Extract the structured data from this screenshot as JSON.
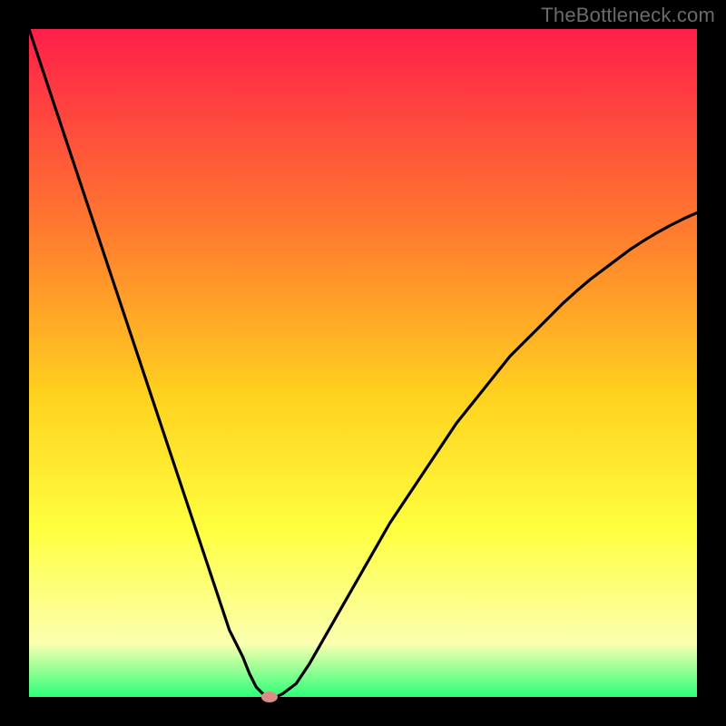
{
  "watermark": "TheBottleneck.com",
  "colors": {
    "black": "#000000",
    "gradient_top": "#ff1f4a",
    "gradient_mid1": "#ff7a2f",
    "gradient_mid2": "#ffd21f",
    "gradient_mid3": "#ffff40",
    "gradient_mid4": "#fbffb0",
    "gradient_bottom": "#2dff79",
    "line": "#000000",
    "dot": "#dd8b87",
    "watermark": "#6b6b6b"
  },
  "chart_data": {
    "type": "line",
    "title": "",
    "xlabel": "",
    "ylabel": "",
    "xlim": [
      0,
      100
    ],
    "ylim": [
      0,
      100
    ],
    "x": [
      0,
      2,
      4,
      6,
      8,
      10,
      12,
      14,
      16,
      18,
      20,
      22,
      24,
      26,
      28,
      30,
      32,
      33,
      34,
      35,
      36,
      37,
      38,
      40,
      42,
      44,
      46,
      48,
      50,
      52,
      54,
      56,
      58,
      60,
      62,
      64,
      66,
      68,
      70,
      72,
      74,
      76,
      78,
      80,
      82,
      84,
      86,
      88,
      90,
      92,
      94,
      96,
      98,
      100
    ],
    "values": [
      100,
      94,
      88,
      82,
      76,
      70,
      64,
      58,
      52,
      46,
      40,
      34,
      28,
      22,
      16,
      10,
      6,
      3.5,
      1.5,
      0.5,
      0,
      0,
      0.5,
      2,
      5,
      8.5,
      12,
      15.5,
      19,
      22.5,
      26,
      29,
      32,
      35,
      38,
      41,
      43.5,
      46,
      48.5,
      51,
      53,
      55,
      57,
      59,
      60.8,
      62.5,
      64,
      65.5,
      67,
      68.3,
      69.5,
      70.6,
      71.6,
      72.5
    ],
    "minimum_x": 36,
    "minimum_y": 0
  }
}
